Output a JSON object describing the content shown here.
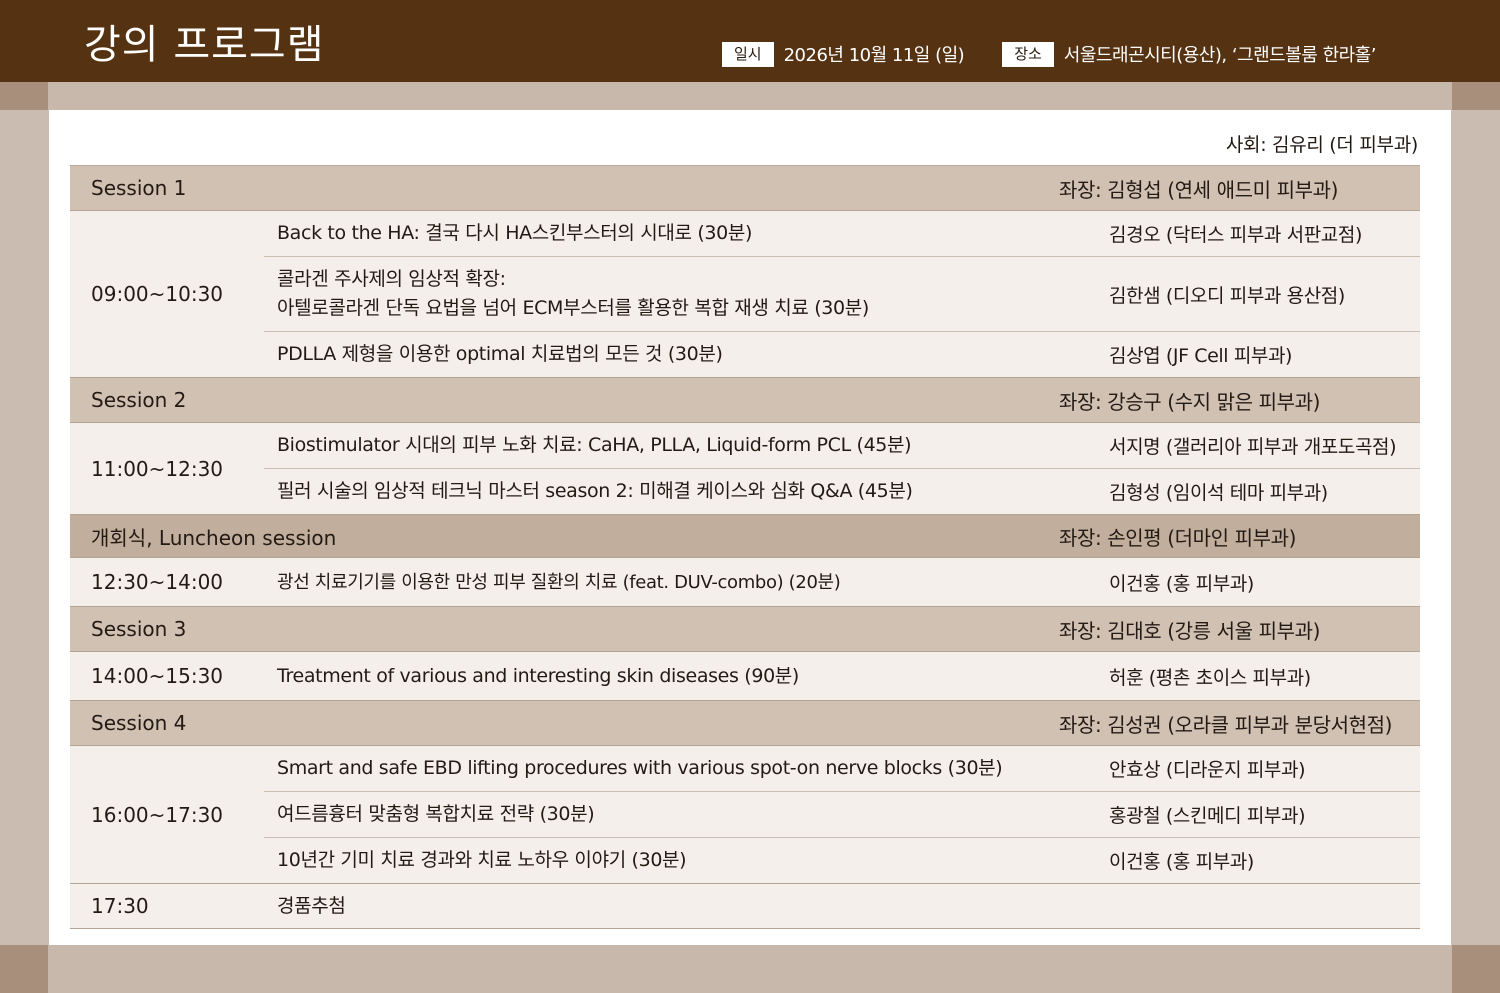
{
  "header": {
    "title": "강의 프로그램",
    "date_tag": "일시",
    "date": "2026년 10월 11일 (일)",
    "venue_tag": "장소",
    "venue": "서울드래곤시티(용산), ‘그랜드볼룸 한라홀’"
  },
  "moderator": "사회:  김유리 (더 피부과)",
  "sessions": [
    {
      "name": "Session 1",
      "chair": "좌장:  김형섭 (연세 애드미 피부과)",
      "time": "09:00~10:30",
      "talks": [
        {
          "topic": "Back to the HA: 결국 다시 HA스킨부스터의 시대로 (30분)",
          "speaker": "김경오 (닥터스 피부과 서판교점)"
        },
        {
          "topic_line1": "콜라겐 주사제의 임상적 확장:",
          "topic_line2": "아텔로콜라겐 단독 요법을 넘어 ECM부스터를 활용한 복합 재생 치료 (30분)",
          "speaker": "김한샘 (디오디 피부과 용산점)"
        },
        {
          "topic": "PDLLA 제형을 이용한 optimal 치료법의 모든 것 (30분)",
          "speaker": "김상엽 (JF Cell 피부과)"
        }
      ]
    },
    {
      "name": "Session 2",
      "chair": "좌장:  강승구 (수지 맑은 피부과)",
      "time": "11:00~12:30",
      "talks": [
        {
          "topic": "Biostimulator 시대의 피부 노화 치료: CaHA, PLLA, Liquid-form PCL (45분)",
          "speaker": "서지명 (갤러리아 피부과 개포도곡점)"
        },
        {
          "topic": "필러 시술의 임상적 테크닉 마스터 season 2: 미해결 케이스와 심화 Q&A (45분)",
          "speaker": "김형성 (임이석 테마 피부과)"
        }
      ]
    },
    {
      "name": "개회식, Luncheon session",
      "chair": "좌장:  손인평 (더마인 피부과)",
      "time": "12:30~14:00",
      "talks": [
        {
          "topic": "광선 치료기기를 이용한 만성 피부 질환의 치료 (feat. DUV-combo) (20분)",
          "speaker": "이건홍 (홍 피부과)"
        }
      ]
    },
    {
      "name": "Session 3",
      "chair": "좌장:  김대호 (강릉 서울 피부과)",
      "time": "14:00~15:30",
      "talks": [
        {
          "topic": "Treatment of various and interesting skin diseases (90분)",
          "speaker": "허훈 (평촌 초이스 피부과)"
        }
      ]
    },
    {
      "name": "Session 4",
      "chair": "좌장:  김성권 (오라클 피부과 분당서현점)",
      "time": "16:00~17:30",
      "talks": [
        {
          "topic": "Smart and safe EBD lifting procedures with various spot-on nerve blocks (30분)",
          "speaker": "안효상 (디라운지 피부과)"
        },
        {
          "topic": "여드름흉터 맞춤형 복합치료 전략 (30분)",
          "speaker": "홍광철 (스킨메디 피부과)"
        },
        {
          "topic": "10년간 기미 치료 경과와 치료 노하우 이야기 (30분)",
          "speaker": "이건홍 (홍 피부과)"
        }
      ]
    }
  ],
  "closing": {
    "time": "17:30",
    "topic": "경품추첨"
  },
  "colors": {
    "header_bg": "#553211",
    "session_bg": "#d0c1b3",
    "luncheon_bg": "#c2ae9c",
    "row_bg": "#f4efea",
    "frame_bg": "#cabcb0"
  }
}
